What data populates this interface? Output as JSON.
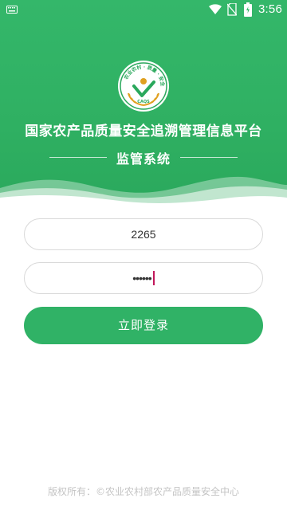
{
  "statusbar": {
    "time": "3:56",
    "icons": [
      "keyboard-icon",
      "wifi-icon",
      "no-sim-icon",
      "battery-icon"
    ]
  },
  "logo": {
    "icon": "cafqs-logo-icon",
    "arc_text": "农业农村 · 质量 · 安全",
    "emblem_label": "CAQS"
  },
  "header": {
    "title": "国家农产品质量安全追溯管理信息平台",
    "subtitle": "监管系统"
  },
  "form": {
    "username_value": "2265",
    "password_value": "••••••",
    "login_button": "立即登录"
  },
  "footer": {
    "copyright": "版权所有：©农业农村部农产品质量安全中心"
  },
  "colors": {
    "primary_green": "#30b266",
    "field_border": "#d9d9d9",
    "cursor": "#c2185b"
  }
}
